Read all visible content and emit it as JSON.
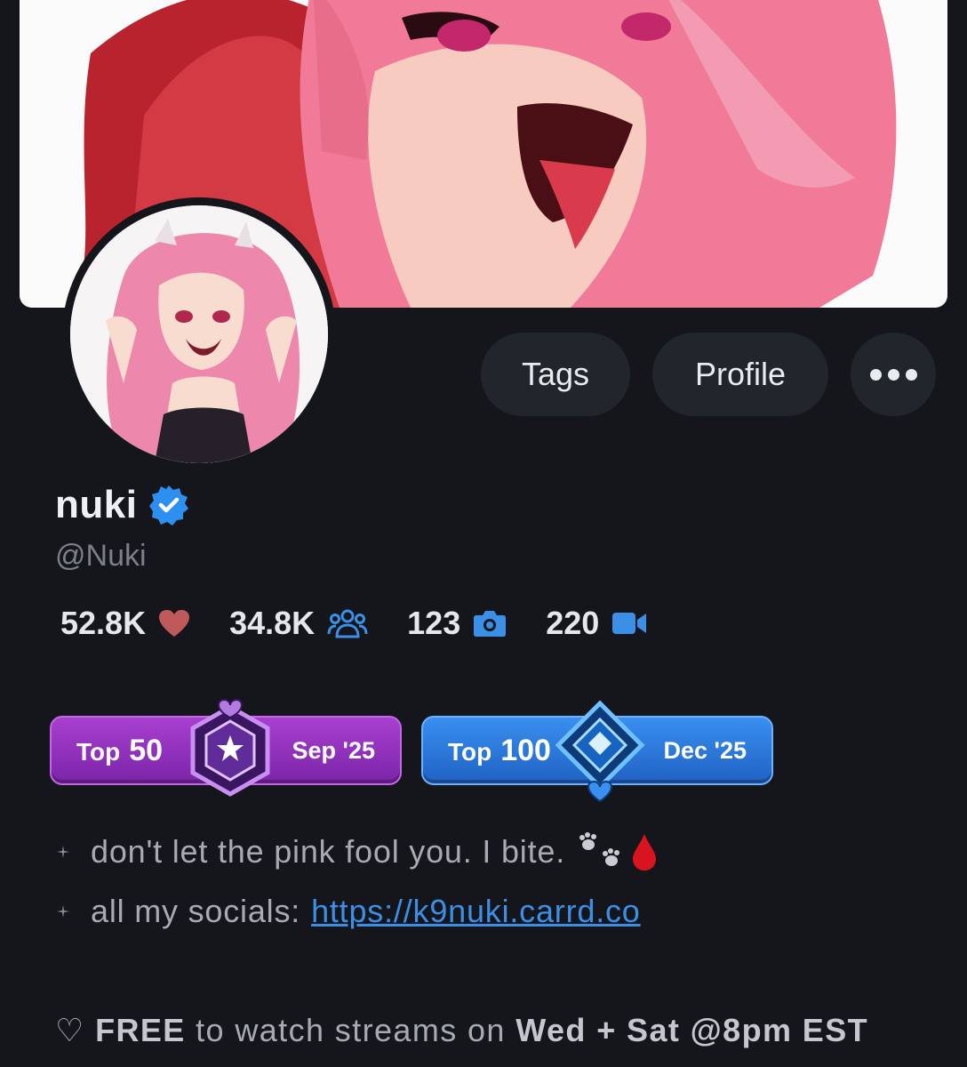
{
  "profile": {
    "display_name": "nuki",
    "handle": "@Nuki",
    "verified_icon": "verified-check-icon"
  },
  "actions": {
    "tags_label": "Tags",
    "profile_label": "Profile",
    "more_icon": "more-dots-icon"
  },
  "stats": {
    "likes": "52.8K",
    "followers": "34.8K",
    "photos": "123",
    "videos": "220"
  },
  "badges": [
    {
      "top_label": "Top",
      "rank": "50",
      "date": "Sep '25",
      "color": "#9b33c7"
    },
    {
      "top_label": "Top",
      "rank": "100",
      "date": "Dec '25",
      "color": "#2f7ee0"
    }
  ],
  "bio": {
    "line1": "don't let the pink fool you. I bite.",
    "line2_prefix": "all my socials:",
    "line2_link": "https://k9nuki.carrd.co",
    "line3_heart": "♡",
    "line3_free": "FREE",
    "line3_mid": " to watch streams on ",
    "line3_days": "Wed + Sat @8pm EST"
  },
  "colors": {
    "background": "#14161b",
    "button_bg": "#21252c",
    "accent_blue": "#3b8fe6",
    "heart": "#c05a5a"
  }
}
